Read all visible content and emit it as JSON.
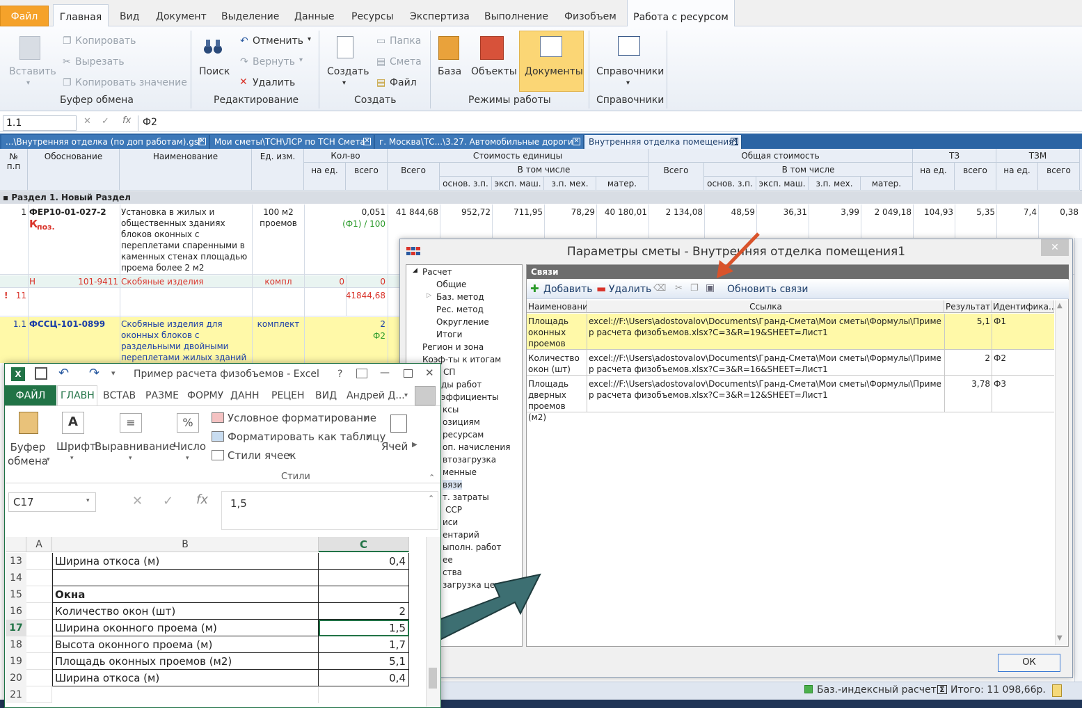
{
  "ribbon": {
    "file": "Файл",
    "tabs": [
      "Главная",
      "Вид",
      "Документ",
      "Выделение",
      "Данные",
      "Ресурсы",
      "Экспертиза",
      "Выполнение",
      "Физобъем"
    ],
    "context_tab": "Работа с ресурсом",
    "paste": "Вставить",
    "copy": "Копировать",
    "cut": "Вырезать",
    "copy_value": "Копировать значение",
    "clipboard_group": "Буфер обмена",
    "search": "Поиск",
    "undo": "Отменить",
    "redo": "Вернуть",
    "delete": "Удалить",
    "edit_group": "Редактирование",
    "create": "Создать",
    "folder": "Папка",
    "estimate": "Смета",
    "file_btn": "Файл",
    "create_group": "Создать",
    "base": "База",
    "objects": "Объекты",
    "documents": "Документы",
    "modes_group": "Режимы работы",
    "references": "Справочники",
    "references_group": "Справочники"
  },
  "formula": {
    "cell": "1.1",
    "value": "Ф2",
    "fx": "fx"
  },
  "doc_tabs": [
    "...\\Внутренняя отделка (по доп работам).gsf",
    "Мои сметы\\ТСН\\ЛСР по ТСН Смета",
    "г. Москва\\ТС...\\3.27. Автомобильные дороги",
    "Внутренняя отделка помещения1"
  ],
  "grid_head": {
    "num": "№\nп.п",
    "basis": "Обоснование",
    "name": "Наименование",
    "unit": "Ед. изм.",
    "qty": "Кол-во",
    "per_unit": "на ед.",
    "total": "всего",
    "unit_cost": "Стоимость единицы",
    "total_cost": "Общая стоимость",
    "all": "Всего",
    "incl": "В том числе",
    "osn": "основ. з.п.",
    "exp": "эксп. маш.",
    "zpmex": "з.п. мех.",
    "mater": "матер.",
    "tz": "ТЗ",
    "tzm": "ТЗМ"
  },
  "section": "Раздел 1. Новый Раздел",
  "rows": {
    "r1": {
      "num": "1",
      "code": "ФЕР10-01-027-2",
      "k": "К",
      "k_suffix": "поз.",
      "name": "Установка в жилых и общественных зданиях блоков оконных с переплетами спаренными в каменных стенах площадью проема более 2 м2",
      "unit": "100 м2 проемов",
      "qty_total": "0,051",
      "qty_formula": "(Ф1) / 100",
      "uc_all": "41 844,68",
      "uc_osn": "952,72",
      "uc_exp": "711,95",
      "uc_zp": "78,29",
      "uc_mat": "40 180,01",
      "tc_all": "2 134,08",
      "tc_osn": "48,59",
      "tc_exp": "36,31",
      "tc_zp": "3,99",
      "tc_mat": "2 049,18",
      "tz_unit": "104,93",
      "tz_total": "5,35",
      "tzm_unit": "7,4",
      "tzm_total": "0,38"
    },
    "h": {
      "mark": "Н",
      "code": "101-9411",
      "name": "Скобяные изделия",
      "unit": "компл",
      "qty_unit": "0",
      "qty_total": "0"
    },
    "x": {
      "mark": "!",
      "num": "11",
      "val": "41844,68"
    },
    "r11": {
      "num": "1.1",
      "code": "ФССЦ-101-0899",
      "name": "Скобяные изделия для оконных блоков с раздельными двойными переплетами жилых зданий",
      "unit": "комплект",
      "qty_total": "2",
      "qty_formula": "Ф2"
    }
  },
  "dialog": {
    "title": "Параметры сметы - Внутренняя отделка помещения1",
    "tree": [
      "Расчет",
      "Общие",
      "Баз. метод",
      "Рес. метод",
      "Округление",
      "Итоги",
      "Регион и зона",
      "Коэф-ты к итогам",
      "СП",
      "ды работ",
      "эффициенты",
      "ксы",
      "озициям",
      "ресурсам",
      "оп. начисления",
      "втозагрузка",
      "менные",
      "вязи",
      "т. затраты",
      "ССР",
      "иси",
      "ентарий",
      "ыполн. работ",
      "ее",
      "ства",
      "загрузка цен"
    ],
    "panel": "Связи",
    "add": "Добавить",
    "remove": "Удалить",
    "refresh": "Обновить связи",
    "cols": [
      "Наименование",
      "Ссылка",
      "Результат",
      "Идентифика..."
    ],
    "links": [
      {
        "name": "Площадь оконных проемов (м2)",
        "url": "excel://F:\\Users\\adostovalov\\Documents\\Гранд-Смета\\Мои сметы\\Формулы\\Пример расчета физобъемов.xlsx?C=3&R=19&SHEET=Лист1",
        "result": "5,1",
        "id": "Ф1"
      },
      {
        "name": "Количество окон (шт)",
        "url": "excel://F:\\Users\\adostovalov\\Documents\\Гранд-Смета\\Мои сметы\\Формулы\\Пример расчета физобъемов.xlsx?C=3&R=16&SHEET=Лист1",
        "result": "2",
        "id": "Ф2"
      },
      {
        "name": "Площадь дверных проемов (м2)",
        "url": "excel://F:\\Users\\adostovalov\\Documents\\Гранд-Смета\\Мои сметы\\Формулы\\Пример расчета физобъемов.xlsx?C=3&R=12&SHEET=Лист1",
        "result": "3,78",
        "id": "Ф3"
      }
    ],
    "ok": "ОК"
  },
  "status": {
    "mode": "Баз.-индексный расчет",
    "total": "Итого: 11 098,66р."
  },
  "excel": {
    "title": "Пример расчета физобъемов - Excel",
    "help": "?",
    "file": "ФАЙЛ",
    "tabs": [
      "ГЛАВН",
      "ВСТАВ",
      "РАЗМЕ",
      "ФОРМУ",
      "ДАНН",
      "РЕЦЕН",
      "ВИД"
    ],
    "user": "Андрей Д...",
    "clipboard": "Буфер\nобмена",
    "font": "Шрифт",
    "align": "Выравнивание",
    "number": "Число",
    "cond": "Условное форматирование",
    "as_table": "Форматировать как таблицу",
    "styles_btn": "Стили ячеек",
    "styles": "Стили",
    "cells": "Ячей",
    "cell_ref": "C17",
    "cell_val": "1,5",
    "col_a": "A",
    "col_b": "B",
    "col_c": "C",
    "rows": [
      {
        "n": "13",
        "b": "Ширина откоса (м)",
        "c": "0,4"
      },
      {
        "n": "14",
        "b": "",
        "c": ""
      },
      {
        "n": "15",
        "b": "Окна",
        "c": ""
      },
      {
        "n": "16",
        "b": "Количество окон (шт)",
        "c": "2"
      },
      {
        "n": "17",
        "b": "Ширина оконного проема (м)",
        "c": "1,5"
      },
      {
        "n": "18",
        "b": "Высота оконного проема (м)",
        "c": "1,7"
      },
      {
        "n": "19",
        "b": "Площадь оконных проемов (м2)",
        "c": "5,1"
      },
      {
        "n": "20",
        "b": "Ширина откоса (м)",
        "c": "0,4"
      },
      {
        "n": "21",
        "b": "",
        "c": ""
      }
    ]
  },
  "colors": {
    "accent": "#f5a22a",
    "excel": "#217346",
    "selected": "#fff9a8",
    "arrow": "#3d6f72",
    "red": "#d9342b"
  }
}
